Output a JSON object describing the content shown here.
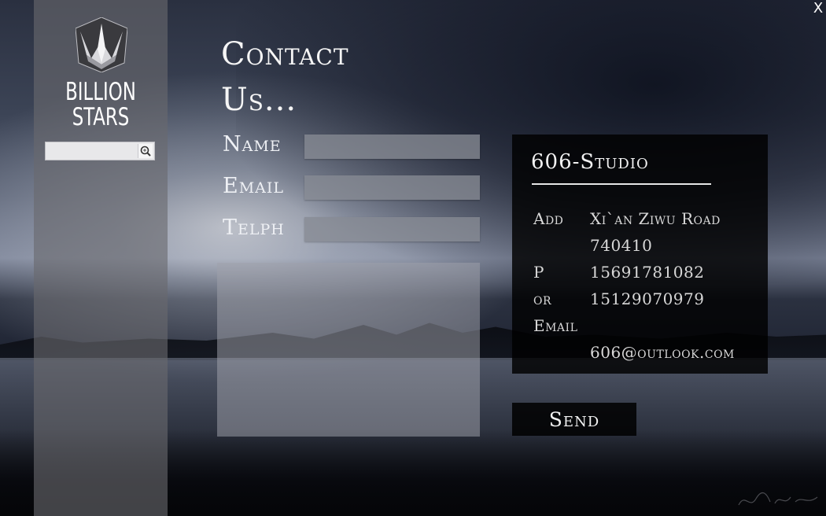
{
  "window": {
    "close_label": "X"
  },
  "sidebar": {
    "brand_line1": "BILLION",
    "brand_line2": "STARS",
    "search": {
      "value": "",
      "placeholder": ""
    }
  },
  "page": {
    "title_line1": "Contact",
    "title_line2": "Us..."
  },
  "form": {
    "name_label": "Name",
    "email_label": "Email",
    "telph_label": "Telph",
    "name_value": "",
    "email_value": "",
    "telph_value": "",
    "message_value": "",
    "send_label": "Send"
  },
  "info": {
    "studio": "606-Studio",
    "rows": [
      {
        "label": "Add",
        "value": "Xi`an Ziwu Road"
      },
      {
        "label": "",
        "value": "740410"
      },
      {
        "label": "P",
        "value": "15691781082"
      },
      {
        "label": "or",
        "value": "15129070979"
      },
      {
        "label": "Email",
        "value": ""
      },
      {
        "label": "",
        "value": "606@outlook.com"
      }
    ]
  },
  "icons": {
    "logo": "crown-logo-icon",
    "search": "magnifier-icon"
  },
  "colors": {
    "sidebar": "#69696e",
    "info_panel": "#000000",
    "field": "#878a94",
    "text": "#f5f5f5"
  }
}
